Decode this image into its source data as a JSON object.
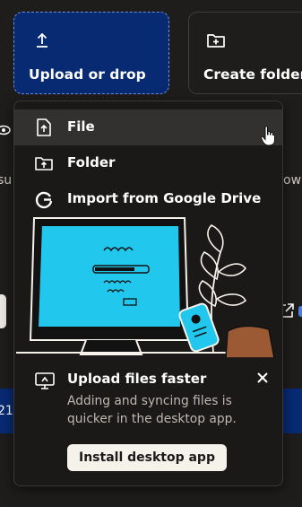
{
  "toolbar": {
    "upload_label": "Upload or drop",
    "create_folder_label": "Create folder"
  },
  "background_fragments": {
    "left_text": "su",
    "right_text": "ow",
    "row_text": "21"
  },
  "upload_menu": {
    "items": [
      {
        "label": "File",
        "icon": "file-upload-icon",
        "hovered": true
      },
      {
        "label": "Folder",
        "icon": "folder-upload-icon",
        "hovered": false
      },
      {
        "label": "Import from Google Drive",
        "icon": "google-g-icon",
        "hovered": false
      }
    ],
    "promo": {
      "title": "Upload files faster",
      "description": "Adding and syncing files is quicker in the desktop app.",
      "button_label": "Install desktop app",
      "icon": "desktop-sync-icon",
      "close_icon": "close-icon"
    }
  },
  "colors": {
    "accent_blue": "#072a73",
    "illustration_screen": "#22c7ee",
    "menu_bg": "#1a1918",
    "hover_bg": "#33312f",
    "page_bg": "#1e1d1c"
  }
}
